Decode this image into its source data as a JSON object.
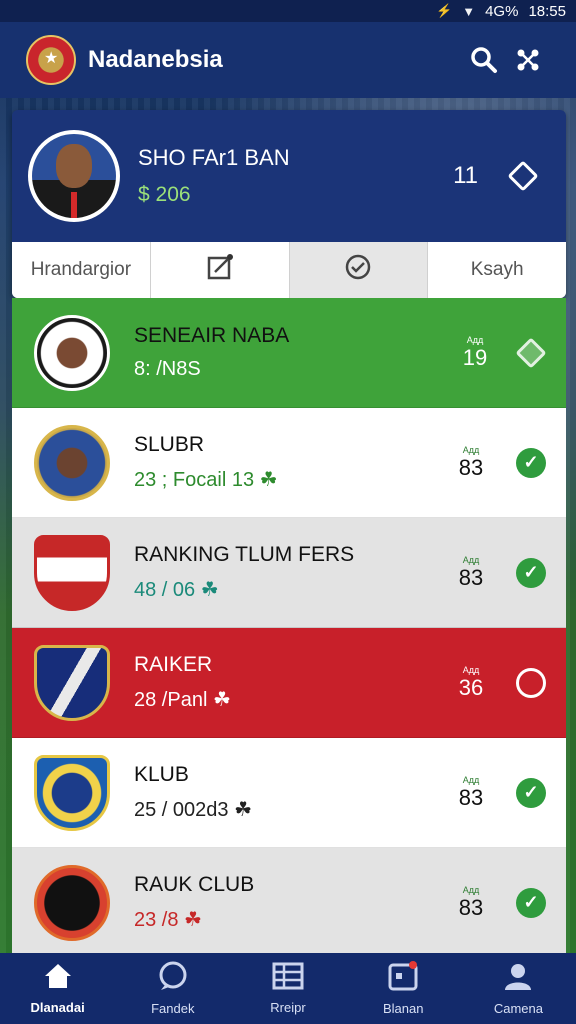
{
  "status_bar": {
    "signal": "⚡",
    "wifi": "▼",
    "battery_text": "4G%",
    "time": "18:55"
  },
  "app_bar": {
    "title": "Nadanebsia",
    "search_icon": "search-icon",
    "share_icon": "share-icon"
  },
  "featured": {
    "name": "SHO FAr1 BAN",
    "sub": "$ 206",
    "count": "11"
  },
  "tabs": [
    {
      "label": "Hrandargior",
      "icon": ""
    },
    {
      "label": "",
      "icon": "edit-icon"
    },
    {
      "label": "",
      "icon": "check-icon"
    },
    {
      "label": "Ksayh",
      "icon": ""
    }
  ],
  "teams": [
    {
      "name": "SENEAIR NABA",
      "sub": "8: /N8S",
      "tiny": "Aдд",
      "num": "19",
      "style": "green",
      "mark": "✓"
    },
    {
      "name": "SLUBR",
      "sub": "23 ; Focail 13 ☘",
      "tiny": "Aдд",
      "num": "83",
      "style": "white",
      "mark": "✓"
    },
    {
      "name": "RANKING TLUM FERS",
      "sub": "48 / 06 ☘",
      "tiny": "Aдд",
      "num": "83",
      "style": "grey",
      "mark": "✓"
    },
    {
      "name": "RAIKER",
      "sub": "28 /Panl ☘",
      "tiny": "Aдд",
      "num": "36",
      "style": "red",
      "mark": ""
    },
    {
      "name": "KLUB",
      "sub": "25 / 002d3 ☘",
      "tiny": "Aдд",
      "num": "83",
      "style": "white",
      "mark": "✓"
    },
    {
      "name": "RAUK CLUB",
      "sub": "23 /8 ☘",
      "tiny": "Aдд",
      "num": "83",
      "style": "grey",
      "mark": "✓"
    }
  ],
  "bottom_nav": [
    {
      "label": "Dlanadai",
      "icon": "home-icon"
    },
    {
      "label": "Fandek",
      "icon": "chat-icon"
    },
    {
      "label": "Rreipr",
      "icon": "table-icon"
    },
    {
      "label": "Blanan",
      "icon": "calendar-icon"
    },
    {
      "label": "Camena",
      "icon": "profile-icon"
    }
  ],
  "colors": {
    "app_bar": "#17316f",
    "green_row": "#3fa33a",
    "red_row": "#c8202a",
    "check": "#2f9c3e"
  }
}
